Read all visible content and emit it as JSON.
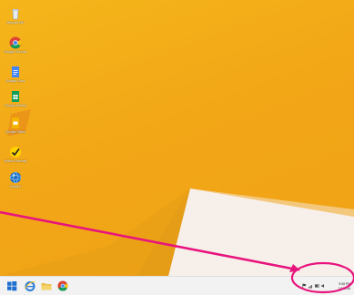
{
  "desktop_icons": [
    {
      "label": "Recycle Bin",
      "icon": "recycle-bin-icon"
    },
    {
      "label": "Google Chrome",
      "icon": "chrome-icon"
    },
    {
      "label": "Google Docs",
      "icon": "google-docs-icon"
    },
    {
      "label": "Google Sheets",
      "icon": "google-sheets-icon"
    },
    {
      "label": "Google Slides",
      "icon": "google-slides-icon"
    },
    {
      "label": "Norton Security",
      "icon": "norton-icon"
    },
    {
      "label": "Install It",
      "icon": "install-globe-icon"
    }
  ],
  "taskbar": {
    "pinned": [
      {
        "name": "start",
        "icon": "windows-logo-icon"
      },
      {
        "name": "internet-explorer",
        "icon": "ie-icon"
      },
      {
        "name": "file-explorer",
        "icon": "folder-icon"
      },
      {
        "name": "chrome",
        "icon": "chrome-icon"
      }
    ],
    "tray": {
      "icons": [
        "flag-icon",
        "network-icon",
        "battery-icon",
        "volume-icon"
      ],
      "time": "9:08 PM",
      "date": "1/1/2016"
    }
  },
  "annotation": {
    "color": "#e8147e",
    "type": "arrow-with-ellipse"
  },
  "colors": {
    "wallpaper": "#f2a717",
    "taskbar": "#f2f2f2",
    "accent": "#e8147e"
  }
}
